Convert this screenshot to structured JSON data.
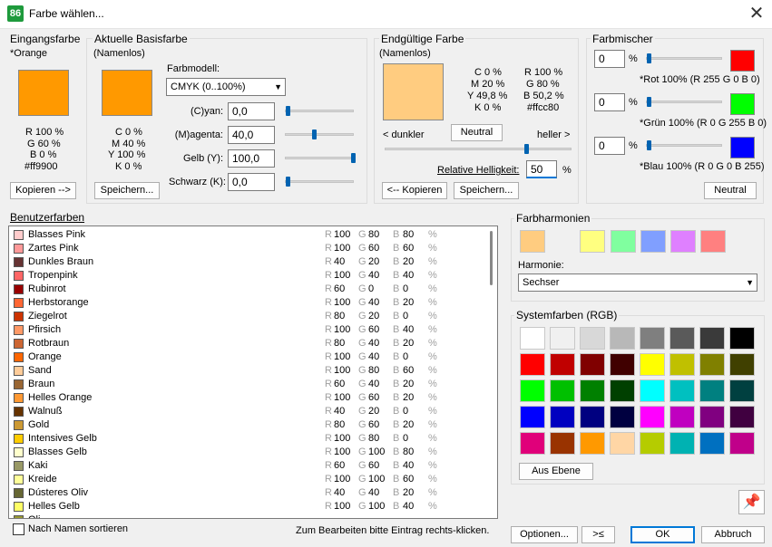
{
  "window": {
    "icon": "app-icon",
    "title": "Farbe wählen...",
    "close": "✕"
  },
  "eingang": {
    "label": "Eingangsfarbe",
    "name": "*Orange",
    "swatch": "#ff9900",
    "r": "R 100 %",
    "g": "G 60 %",
    "b": "B 0 %",
    "hex": "#ff9900",
    "copy_btn": "Kopieren -->"
  },
  "basis": {
    "label": "Aktuelle Basisfarbe",
    "name": "(Namenlos)",
    "swatch": "#ff9900",
    "c": "C 0 %",
    "m": "M 40 %",
    "y": "Y 100 %",
    "k": "K 0 %",
    "save_btn": "Speichern...",
    "model_label": "Farbmodell:",
    "model_value": "CMYK (0..100%)",
    "fields": [
      {
        "label": "(C)yan:",
        "value": "0,0",
        "level": 0
      },
      {
        "label": "(M)agenta:",
        "value": "40,0",
        "level": 0.4
      },
      {
        "label": "Gelb (Y):",
        "value": "100,0",
        "level": 1
      },
      {
        "label": "Schwarz (K):",
        "value": "0,0",
        "level": 0
      }
    ]
  },
  "endg": {
    "label": "Endgültige Farbe",
    "name": "(Namenlos)",
    "swatch": "#ffcc80",
    "c": "C 0 %",
    "m": "M 20 %",
    "y": "Y 49,8 %",
    "k": "K 0 %",
    "r": "R 100 %",
    "g": "G 80 %",
    "b": "B 50,2 %",
    "hex": "#ffcc80",
    "darker": "< dunkler",
    "neutral_btn": "Neutral",
    "brighter": "heller >",
    "brightness_level": 0.75,
    "rel_label": "Relative Helligkeit:",
    "rel_value": "50",
    "pct": "%",
    "copy_btn": "<-- Kopieren",
    "save_btn": "Speichern..."
  },
  "mischer": {
    "label": "Farbmischer",
    "rows": [
      {
        "value": "0",
        "pct": "%",
        "caption": "*Rot 100% (R 255 G 0 B 0)",
        "color": "#ff0000"
      },
      {
        "value": "0",
        "pct": "%",
        "caption": "*Grün 100% (R 0 G 255 B 0)",
        "color": "#00ff00"
      },
      {
        "value": "0",
        "pct": "%",
        "caption": "*Blau 100% (R 0 G 0 B 255)",
        "color": "#0000ff"
      }
    ],
    "neutral_btn": "Neutral"
  },
  "benutzer": {
    "label": "Benutzerfarben",
    "rows": [
      {
        "name": "Blasses Pink",
        "color": "#ffcccc",
        "r": "100",
        "g": "80",
        "b": "80"
      },
      {
        "name": "Zartes Pink",
        "color": "#ff9999",
        "r": "100",
        "g": "60",
        "b": "60"
      },
      {
        "name": "Dunkles Braun",
        "color": "#663333",
        "r": "40",
        "g": "20",
        "b": "20"
      },
      {
        "name": "Tropenpink",
        "color": "#ff6666",
        "r": "100",
        "g": "40",
        "b": "40"
      },
      {
        "name": "Rubinrot",
        "color": "#990000",
        "r": "60",
        "g": "0",
        "b": "0"
      },
      {
        "name": "Herbstorange",
        "color": "#ff6633",
        "r": "100",
        "g": "40",
        "b": "20"
      },
      {
        "name": "Ziegelrot",
        "color": "#cc3300",
        "r": "80",
        "g": "20",
        "b": "0"
      },
      {
        "name": "Pfirsich",
        "color": "#ff9966",
        "r": "100",
        "g": "60",
        "b": "40"
      },
      {
        "name": "Rotbraun",
        "color": "#cc6633",
        "r": "80",
        "g": "40",
        "b": "20"
      },
      {
        "name": "Orange",
        "color": "#ff6600",
        "r": "100",
        "g": "40",
        "b": "0"
      },
      {
        "name": "Sand",
        "color": "#ffcc99",
        "r": "100",
        "g": "80",
        "b": "60"
      },
      {
        "name": "Braun",
        "color": "#996633",
        "r": "60",
        "g": "40",
        "b": "20"
      },
      {
        "name": "Helles Orange",
        "color": "#ff9933",
        "r": "100",
        "g": "60",
        "b": "20"
      },
      {
        "name": "Walnuß",
        "color": "#663300",
        "r": "40",
        "g": "20",
        "b": "0"
      },
      {
        "name": "Gold",
        "color": "#cc9933",
        "r": "80",
        "g": "60",
        "b": "20"
      },
      {
        "name": "Intensives Gelb",
        "color": "#ffcc00",
        "r": "100",
        "g": "80",
        "b": "0"
      },
      {
        "name": "Blasses Gelb",
        "color": "#ffffcc",
        "r": "100",
        "g": "100",
        "b": "80"
      },
      {
        "name": "Kaki",
        "color": "#999966",
        "r": "60",
        "g": "60",
        "b": "40"
      },
      {
        "name": "Kreide",
        "color": "#ffff99",
        "r": "100",
        "g": "100",
        "b": "60"
      },
      {
        "name": "Dústeres Oliv",
        "color": "#666633",
        "r": "40",
        "g": "40",
        "b": "20"
      },
      {
        "name": "Helles Gelb",
        "color": "#ffff66",
        "r": "100",
        "g": "100",
        "b": "40"
      },
      {
        "name": "Oli",
        "color": "#999933",
        "r": "",
        "g": "",
        "b": ""
      }
    ],
    "rl": "R",
    "gl": "G",
    "bl": "B",
    "pct": "%",
    "sort_label": "Nach Namen sortieren",
    "hint": "Zum Bearbeiten bitte Eintrag rechts-klicken."
  },
  "harmonien": {
    "label": "Farbharmonien",
    "swatches": [
      "#ffcc80",
      "#ffff80",
      "#80ff9f",
      "#809fff",
      "#df80ff",
      "#ff8080"
    ],
    "harm_label": "Harmonie:",
    "harm_value": "Sechser"
  },
  "system": {
    "label": "Systemfarben (RGB)",
    "colors": [
      "#ffffff",
      "#f0f0f0",
      "#d8d8d8",
      "#b8b8b8",
      "#7f7f7f",
      "#5a5a5a",
      "#3a3a3a",
      "#000000",
      "#ff0000",
      "#c00000",
      "#800000",
      "#400000",
      "#ffff00",
      "#c0c000",
      "#808000",
      "#404000",
      "#00ff00",
      "#00c000",
      "#008000",
      "#004000",
      "#00ffff",
      "#00c0c0",
      "#008080",
      "#004040",
      "#0000ff",
      "#0000c0",
      "#000080",
      "#000040",
      "#ff00ff",
      "#c000c0",
      "#800080",
      "#400040",
      "#e0007a",
      "#993300",
      "#ff9900",
      "#ffd6a5",
      "#b5cc00",
      "#00b2b2",
      "#0070c0",
      "#c0008a"
    ],
    "from_layer_btn": "Aus Ebene"
  },
  "footer": {
    "options_btn": "Optionen...",
    "collapse_btn": ">≤",
    "ok_btn": "OK",
    "cancel_btn": "Abbruch"
  }
}
